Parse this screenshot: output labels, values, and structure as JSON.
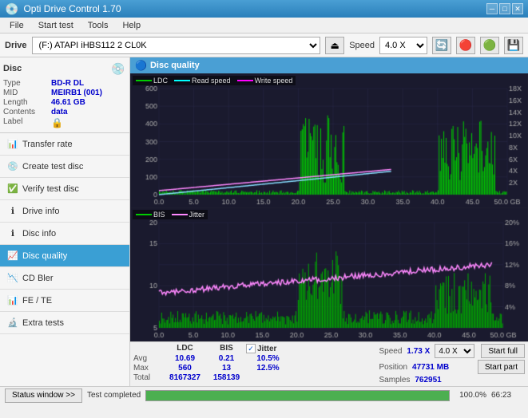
{
  "titleBar": {
    "title": "Opti Drive Control 1.70",
    "minimizeLabel": "─",
    "maximizeLabel": "□",
    "closeLabel": "✕"
  },
  "menuBar": {
    "items": [
      "File",
      "Start test",
      "Tools",
      "Help"
    ]
  },
  "driveBar": {
    "driveLabel": "Drive",
    "driveValue": "(F:) ATAPI iHBS112 2 CL0K",
    "speedLabel": "Speed",
    "speedValue": "4.0 X"
  },
  "discSection": {
    "title": "Disc",
    "type": "BD-R DL",
    "mid": "MEIRB1 (001)",
    "length": "46.61 GB",
    "contents": "data",
    "label": ""
  },
  "navItems": [
    {
      "id": "transfer-rate",
      "label": "Transfer rate",
      "active": false
    },
    {
      "id": "create-test-disc",
      "label": "Create test disc",
      "active": false
    },
    {
      "id": "verify-test-disc",
      "label": "Verify test disc",
      "active": false
    },
    {
      "id": "drive-info",
      "label": "Drive info",
      "active": false
    },
    {
      "id": "disc-info",
      "label": "Disc info",
      "active": false
    },
    {
      "id": "disc-quality",
      "label": "Disc quality",
      "active": true
    },
    {
      "id": "cd-bler",
      "label": "CD Bler",
      "active": false
    },
    {
      "id": "fe-te",
      "label": "FE / TE",
      "active": false
    },
    {
      "id": "extra-tests",
      "label": "Extra tests",
      "active": false
    }
  ],
  "discQuality": {
    "title": "Disc quality",
    "legend1": {
      "ldc": "LDC",
      "readSpeed": "Read speed",
      "writeSpeed": "Write speed"
    },
    "legend2": {
      "bis": "BIS",
      "jitter": "Jitter"
    },
    "xAxisMax": "50.0 GB",
    "chart1YMax": "600",
    "chart2YMax": "20"
  },
  "stats": {
    "headers": [
      "LDC",
      "BIS",
      "Jitter"
    ],
    "avgLabel": "Avg",
    "maxLabel": "Max",
    "totalLabel": "Total",
    "avgLDC": "10.69",
    "avgBIS": "0.21",
    "avgJitter": "10.5%",
    "maxLDC": "560",
    "maxBIS": "13",
    "maxJitter": "12.5%",
    "totalLDC": "8167327",
    "totalBIS": "158139",
    "speedLabel": "Speed",
    "speedValue": "1.73 X",
    "speedMax": "4.0 X",
    "positionLabel": "Position",
    "positionValue": "47731 MB",
    "samplesLabel": "Samples",
    "samplesValue": "762951",
    "startFullLabel": "Start full",
    "startPartLabel": "Start part"
  },
  "statusBar": {
    "statusWindowLabel": "Status window >>",
    "statusText": "Test completed",
    "progressValue": "100.0",
    "progressDisplay": "100.0%",
    "timeValue": "66:23"
  }
}
